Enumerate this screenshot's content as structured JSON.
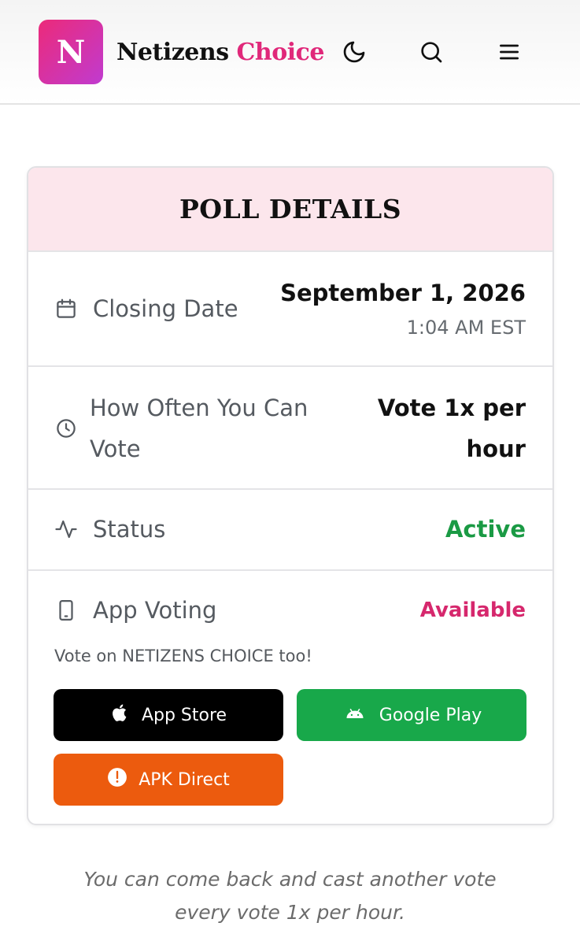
{
  "header": {
    "logo_letter": "N",
    "brand_first": "Netizens",
    "brand_second": "Choice",
    "icons": [
      "moon-icon",
      "search-icon",
      "menu-icon"
    ]
  },
  "poll": {
    "title": "POLL DETAILS",
    "closing_date": {
      "label": "Closing Date",
      "value": "September 1, 2026",
      "time": "1:04 AM EST",
      "icon": "calendar-icon"
    },
    "frequency": {
      "label_line1": "How Often You Can",
      "label_line2": "Vote",
      "value_line1": "Vote 1x per",
      "value_line2": "hour",
      "icon": "clock-icon"
    },
    "status": {
      "label": "Status",
      "value": "Active",
      "value_color": "#1a9a44",
      "icon": "activity-icon"
    },
    "app_voting": {
      "label": "App Voting",
      "value": "Available",
      "value_color": "#d6286d",
      "icon": "phone-icon",
      "note": "Vote on NETIZENS CHOICE too!",
      "buttons": {
        "app_store": "App Store",
        "google_play": "Google Play",
        "apk_direct": "APK Direct"
      }
    }
  },
  "footer": {
    "line1": "You can come back and cast another vote",
    "line2": "every vote 1x per hour."
  },
  "colors": {
    "brand_pink": "#e0287a",
    "app_store_bg": "#000000",
    "google_play_bg": "#18a84a",
    "apk_bg": "#ec5b0e",
    "card_header_bg": "#fce6ec"
  }
}
